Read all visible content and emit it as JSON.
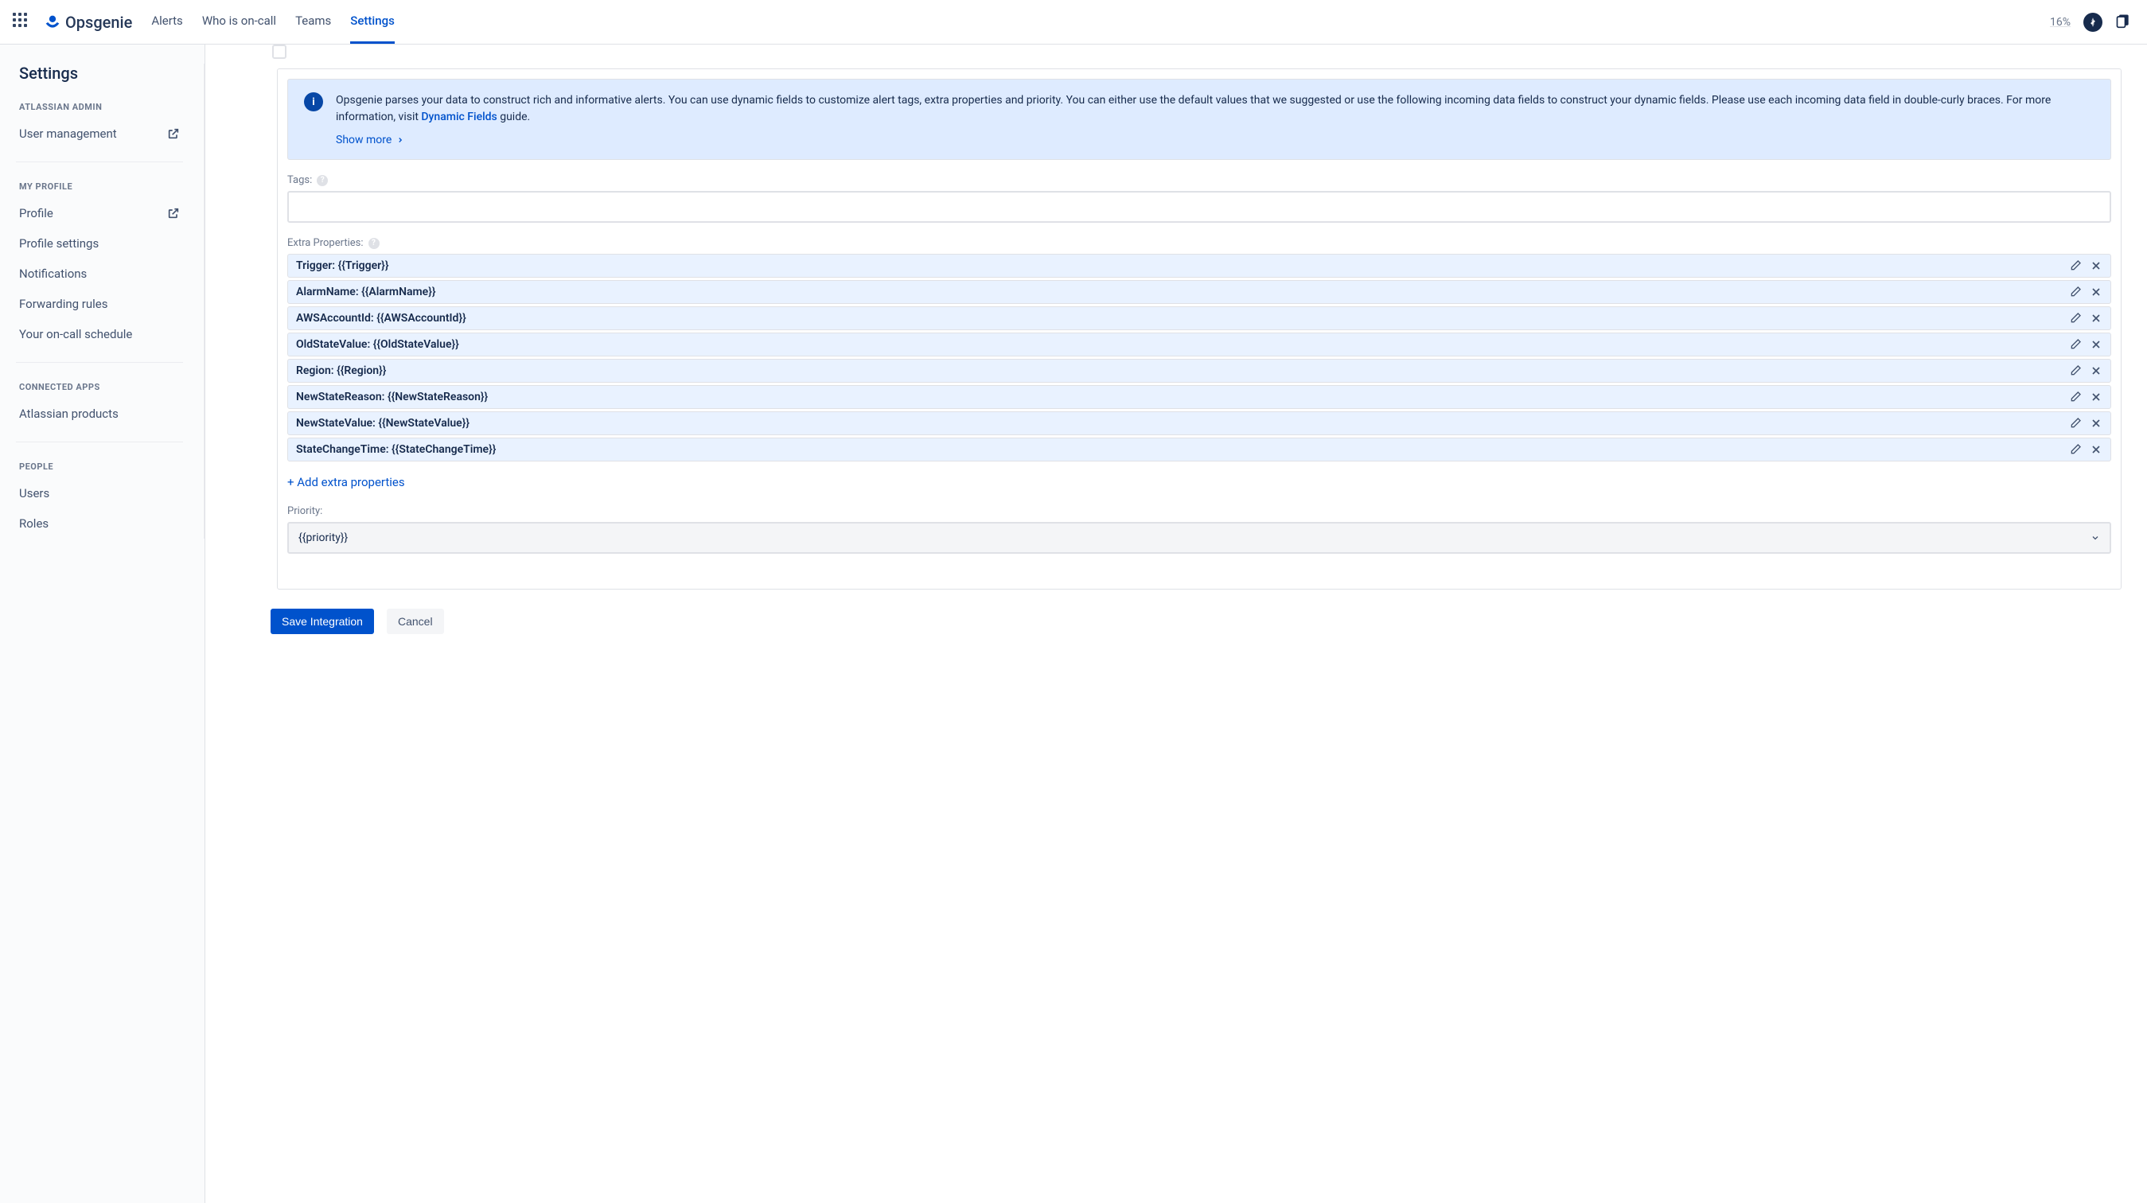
{
  "header": {
    "logo_text": "Opsgenie",
    "nav": [
      "Alerts",
      "Who is on-call",
      "Teams",
      "Settings"
    ],
    "active_nav_index": 3,
    "percent": "16%"
  },
  "sidebar": {
    "title": "Settings",
    "sections": [
      {
        "heading": "ATLASSIAN ADMIN",
        "items": [
          {
            "label": "User management",
            "external": true
          }
        ]
      },
      {
        "heading": "MY PROFILE",
        "items": [
          {
            "label": "Profile",
            "external": true
          },
          {
            "label": "Profile settings",
            "external": false
          },
          {
            "label": "Notifications",
            "external": false
          },
          {
            "label": "Forwarding rules",
            "external": false
          },
          {
            "label": "Your on-call schedule",
            "external": false
          }
        ]
      },
      {
        "heading": "CONNECTED APPS",
        "items": [
          {
            "label": "Atlassian products",
            "external": false
          }
        ]
      },
      {
        "heading": "PEOPLE",
        "items": [
          {
            "label": "Users",
            "external": false
          },
          {
            "label": "Roles",
            "external": false
          }
        ]
      }
    ]
  },
  "main": {
    "info_text_pre": "Opsgenie parses your data to construct rich and informative alerts. You can use dynamic fields to customize alert tags, extra properties and priority. You can either use the default values that we suggested or use the following incoming data fields to construct your dynamic fields. Please use each incoming data field in double-curly braces. For more information, visit ",
    "info_link": "Dynamic Fields",
    "info_text_post": " guide.",
    "show_more": "Show more",
    "tags_label": "Tags:",
    "extra_props_label": "Extra Properties:",
    "extra_props": [
      "Trigger: {{Trigger}}",
      "AlarmName: {{AlarmName}}",
      "AWSAccountId: {{AWSAccountId}}",
      "OldStateValue: {{OldStateValue}}",
      "Region: {{Region}}",
      "NewStateReason: {{NewStateReason}}",
      "NewStateValue: {{NewStateValue}}",
      "StateChangeTime: {{StateChangeTime}}"
    ],
    "add_props_link": "+ Add extra properties",
    "priority_label": "Priority:",
    "priority_value": "{{priority}}",
    "save_button": "Save Integration",
    "cancel_button": "Cancel"
  }
}
